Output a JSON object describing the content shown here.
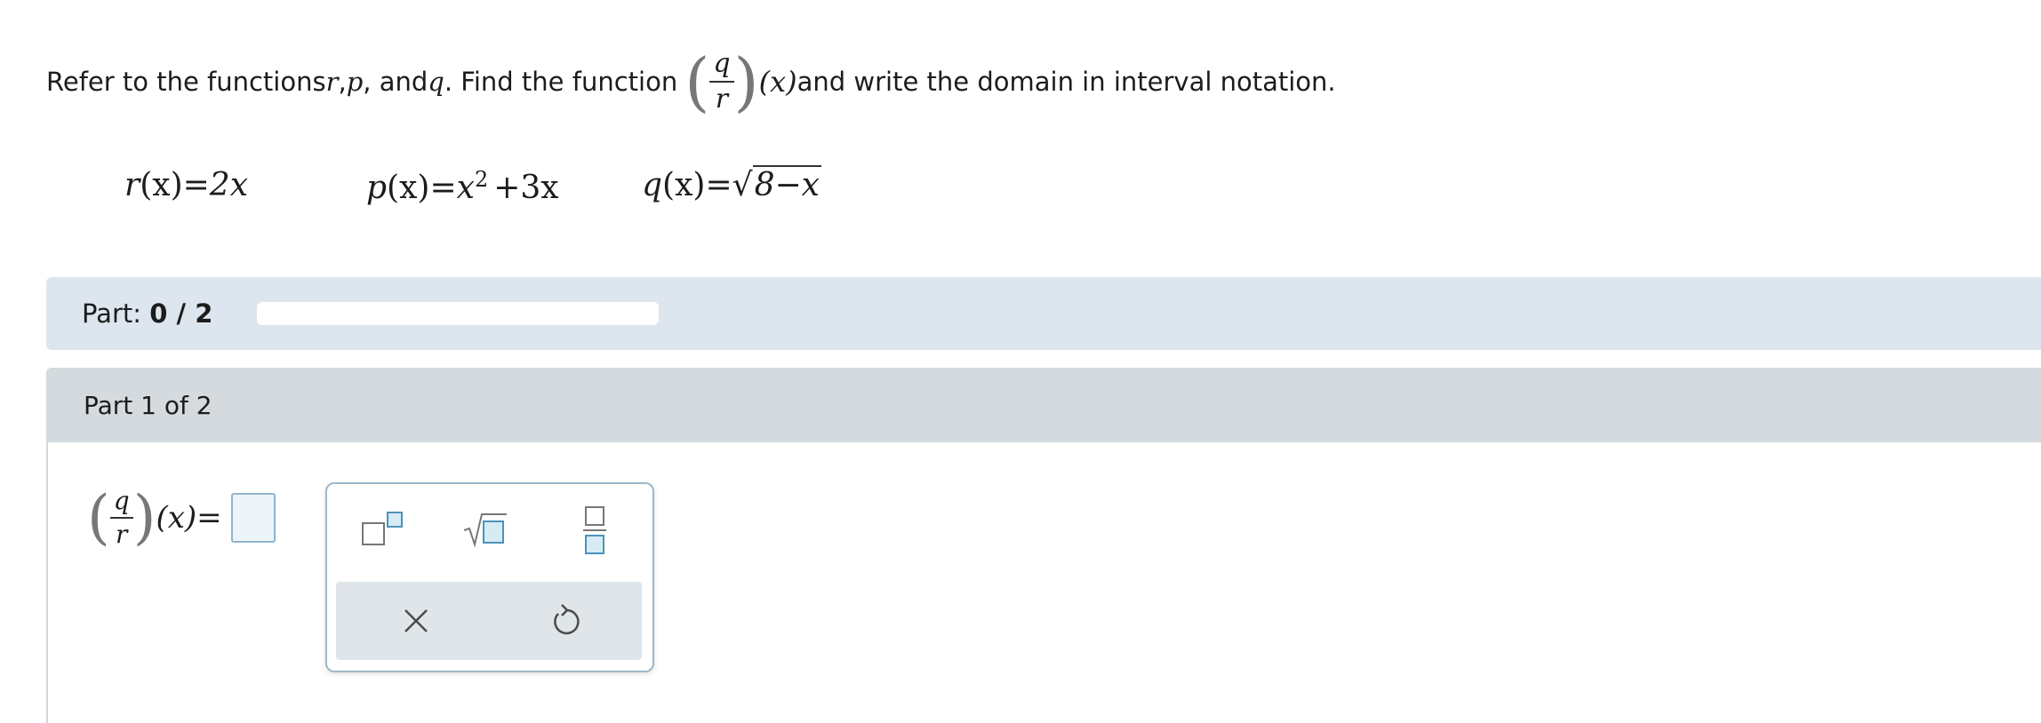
{
  "prompt": {
    "text1": "Refer to the functions ",
    "var_r": "r",
    "comma1": ", ",
    "var_p": "p",
    "and_text": ", and ",
    "var_q": "q",
    "text2": ". Find the function ",
    "frac_num": "q",
    "frac_den": "r",
    "arg": "(x)",
    "text3": " and write the domain in interval notation."
  },
  "functions": {
    "r": {
      "name": "r",
      "lhs_arg": "(x)",
      "eq": "=",
      "rhs": "2x"
    },
    "p": {
      "name": "p",
      "lhs_arg": "(x)",
      "eq": "=",
      "rhs_base": "x",
      "rhs_exp": "2",
      "rhs_rest": "+3x"
    },
    "q": {
      "name": "q",
      "lhs_arg": "(x)",
      "eq": "=",
      "radical": "√",
      "radicand": "8−x"
    }
  },
  "progress": {
    "label": "Part:",
    "value": "0 / 2",
    "fraction": 0
  },
  "part": {
    "title": "Part 1 of 2"
  },
  "answer": {
    "frac_num": "q",
    "frac_den": "r",
    "arg": "(x)",
    "eq": "="
  },
  "toolbar": {
    "exponent_icon": "exponent-icon",
    "sqrt_icon": "square-root-icon",
    "fraction_icon": "fraction-icon",
    "clear_icon": "close-icon",
    "undo_icon": "undo-icon",
    "clear_glyph": "×",
    "accent": "#4b93b8"
  }
}
